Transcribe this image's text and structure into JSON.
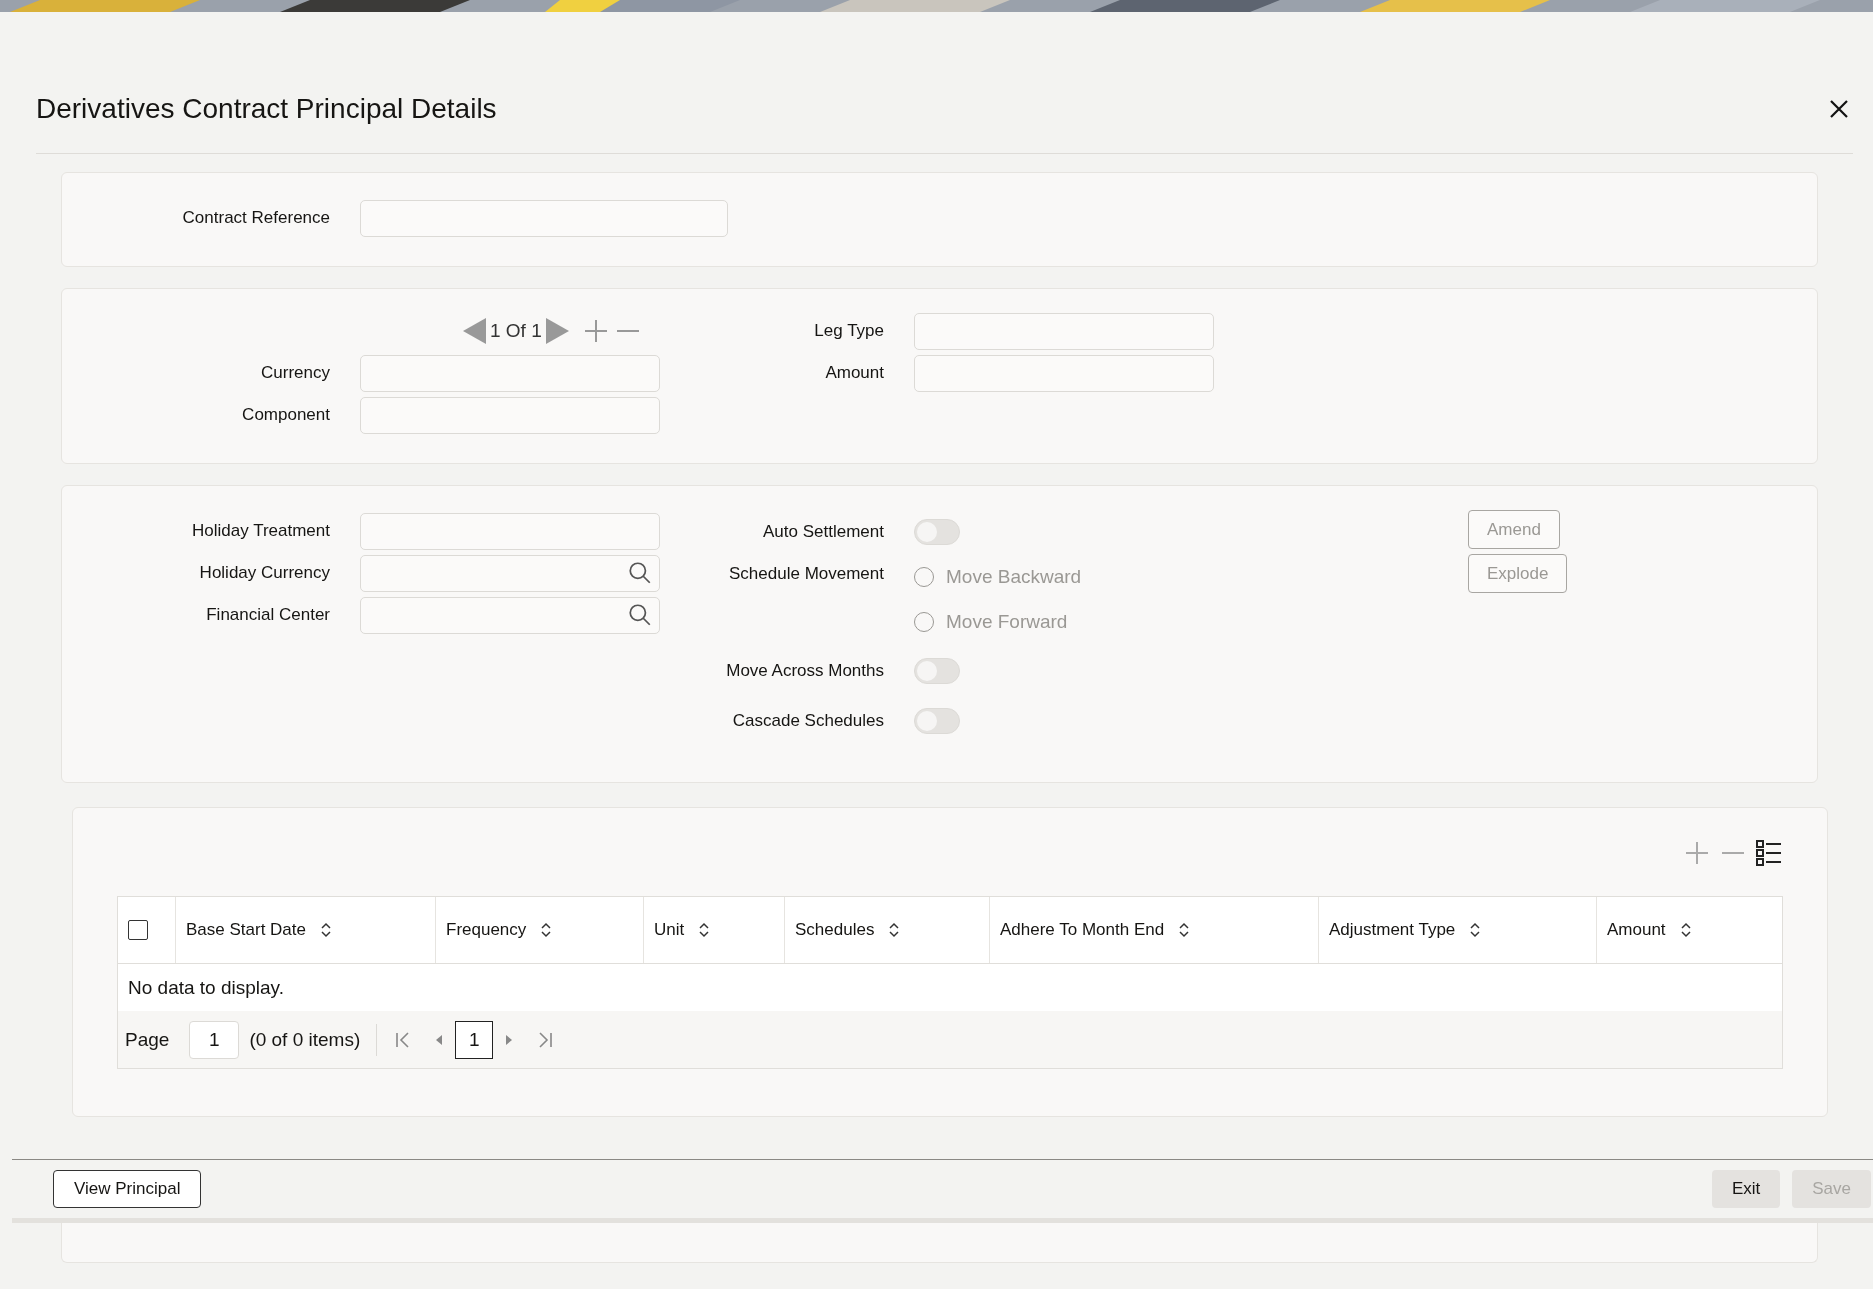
{
  "title": "Derivatives Contract Principal Details",
  "contract_section": {
    "fields": [
      {
        "label": "Contract Reference"
      }
    ]
  },
  "leg_section": {
    "navigator": {
      "position": "1 Of 1"
    },
    "left_fields": [
      {
        "label": "Currency"
      },
      {
        "label": "Component"
      }
    ],
    "right_fields": [
      {
        "label": "Leg Type"
      },
      {
        "label": "Amount"
      }
    ]
  },
  "holiday_section": {
    "left_fields": [
      {
        "label": "Holiday Treatment",
        "kind": "text"
      },
      {
        "label": "Holiday Currency",
        "kind": "lov"
      },
      {
        "label": "Financial Center",
        "kind": "lov"
      }
    ],
    "options": [
      {
        "label": "Auto Settlement",
        "kind": "toggle",
        "on": false
      },
      {
        "label": "Schedule Movement",
        "kind": "radio",
        "choices": [
          {
            "label": "Move Backward",
            "selected": false
          },
          {
            "label": "Move Forward",
            "selected": false
          }
        ]
      },
      {
        "label": "Move Across Months",
        "kind": "toggle",
        "on": false
      },
      {
        "label": "Cascade Schedules",
        "kind": "toggle",
        "on": false
      }
    ],
    "buttons": [
      {
        "label": "Amend",
        "disabled": true
      },
      {
        "label": "Explode",
        "disabled": true
      }
    ]
  },
  "schedule_table": {
    "select_all_checked": false,
    "columns": [
      "Base Start Date",
      "Frequency",
      "Unit",
      "Schedules",
      "Adhere To Month End",
      "Adjustment Type",
      "Amount"
    ],
    "empty_text": "No data to display.",
    "pager": {
      "label": "Page",
      "page_value": "1",
      "summary": "(0 of 0 items)",
      "current_page": "1"
    }
  },
  "footer": {
    "left_button": {
      "label": "View Principal"
    },
    "right_buttons": [
      {
        "label": "Exit",
        "disabled": false
      },
      {
        "label": "Save",
        "disabled": true
      }
    ]
  }
}
